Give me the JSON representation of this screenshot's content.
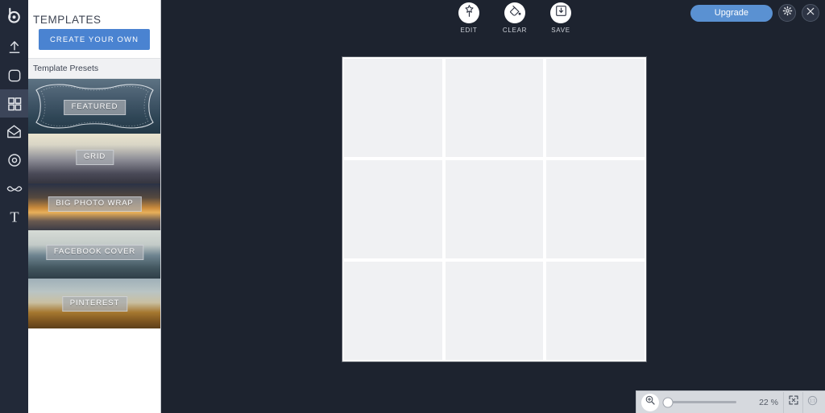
{
  "app": {
    "background_color": "#1d232f",
    "rail_color": "#222938"
  },
  "rail": {
    "logo_name": "app-logo",
    "items": [
      {
        "name": "sidebar-item-upload",
        "icon": "upload-arrow-icon",
        "active": false
      },
      {
        "name": "sidebar-item-frames",
        "icon": "rounded-square-icon",
        "active": false
      },
      {
        "name": "sidebar-item-templates",
        "icon": "grid-squares-icon",
        "active": true
      },
      {
        "name": "sidebar-item-cards",
        "icon": "open-envelope-icon",
        "active": false
      },
      {
        "name": "sidebar-item-stickers",
        "icon": "target-circle-icon",
        "active": false
      },
      {
        "name": "sidebar-item-overlays",
        "icon": "mustache-icon",
        "active": false
      },
      {
        "name": "sidebar-item-text",
        "icon": "text-t-icon",
        "active": false
      }
    ]
  },
  "panel": {
    "title": "TEMPLATES",
    "create_button": "CREATE YOUR OWN",
    "section_header": "Template Presets",
    "accent_color": "#4a83d1",
    "presets": [
      {
        "label": "FEATURED",
        "height": 68,
        "label_top": 26,
        "theme": "ocean-frame"
      },
      {
        "label": "GRID",
        "height": 62,
        "label_top": 20,
        "theme": "cityscape"
      },
      {
        "label": "BIG PHOTO WRAP",
        "height": 58,
        "label_top": 16,
        "theme": "sunset-road"
      },
      {
        "label": "FACEBOOK COVER",
        "height": 60,
        "label_top": 18,
        "theme": "harbor-canal"
      },
      {
        "label": "PINTEREST",
        "height": 62,
        "label_top": 22,
        "theme": "field-sky"
      }
    ]
  },
  "toolbar": {
    "tools": [
      {
        "label": "EDIT",
        "icon": "magic-wand-icon",
        "name": "edit-tool"
      },
      {
        "label": "CLEAR",
        "icon": "paint-bucket-icon",
        "name": "clear-tool"
      },
      {
        "label": "SAVE",
        "icon": "save-disk-icon",
        "name": "save-tool"
      }
    ]
  },
  "topbar": {
    "upgrade_label": "Upgrade",
    "upgrade_color": "#5a91d2",
    "settings_icon": "gear-icon",
    "close_icon": "close-x-icon"
  },
  "canvas": {
    "grid_rows": 3,
    "grid_cols": 3,
    "cell_color": "#f0f1f3",
    "gutter_color": "#ffffff"
  },
  "zoombar": {
    "zoom_icon": "magnifier-plus-icon",
    "zoom_value": "22 %",
    "slider_percent": 3,
    "fit_icon": "fit-to-screen-icon",
    "actual_size_icon": "one-to-one-icon"
  }
}
